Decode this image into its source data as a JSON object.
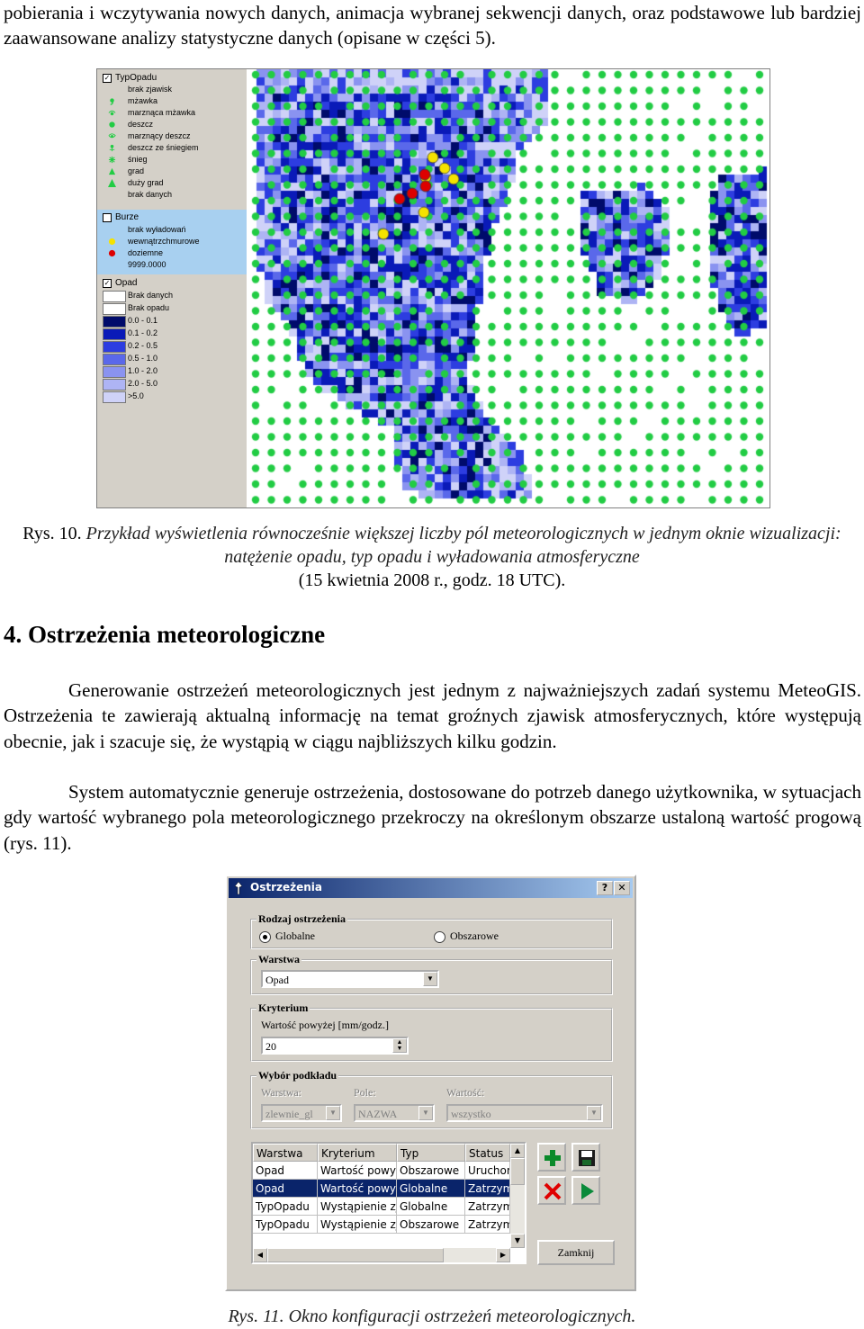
{
  "intro_text": "pobierania i wczytywania nowych danych, animacja wybranej sekwencji danych, oraz podstawowe lub bardziej zaawansowane analizy statystyczne danych (opisane w części 5).",
  "figure10": {
    "legend": {
      "typ_opadu": {
        "header": "TypOpadu",
        "items": [
          {
            "label": "brak zjawisk",
            "icon": "none"
          },
          {
            "label": "mżawka",
            "icon": "comma-icon"
          },
          {
            "label": "marznąca mżawka",
            "icon": "freezing-drizzle-icon"
          },
          {
            "label": "deszcz",
            "icon": "dot-icon"
          },
          {
            "label": "marznący deszcz",
            "icon": "freezing-rain-icon"
          },
          {
            "label": "deszcz ze śniegiem",
            "icon": "rain-snow-icon"
          },
          {
            "label": "śnieg",
            "icon": "snow-icon"
          },
          {
            "label": "grad",
            "icon": "hail-triangle-icon"
          },
          {
            "label": "duży grad",
            "icon": "large-hail-triangle-icon"
          },
          {
            "label": "brak danych",
            "icon": "none"
          }
        ]
      },
      "burze": {
        "header": "Burze",
        "items": [
          {
            "label": "brak wyładowań",
            "icon": "none"
          },
          {
            "label": "wewnątrzchmurowe",
            "icon": "yellow-dot-icon"
          },
          {
            "label": "doziemne",
            "icon": "red-dot-icon"
          },
          {
            "label": "9999.0000",
            "icon": "none"
          }
        ]
      },
      "opad": {
        "header": "Opad",
        "items": [
          {
            "label": "Brak danych",
            "color": "#ffffff"
          },
          {
            "label": "Brak opadu",
            "color": "#ffffff"
          },
          {
            "label": "0.0 - 0.1",
            "color": "#000b6b"
          },
          {
            "label": "0.1 - 0.2",
            "color": "#0a1ab8"
          },
          {
            "label": "0.2 - 0.5",
            "color": "#2d3de0"
          },
          {
            "label": "0.5 - 1.0",
            "color": "#5a68ea"
          },
          {
            "label": "1.0 - 2.0",
            "color": "#8a93f0"
          },
          {
            "label": "2.0 - 5.0",
            "color": "#aeb4f4"
          },
          {
            "label": ">5.0",
            "color": "#cfd2f8"
          }
        ]
      }
    },
    "colors": {
      "green_point": "#22cc44",
      "yellow_point": "#f5e200",
      "red_point": "#dd0000"
    },
    "caption_number": "Rys. 10.",
    "caption_italic": "Przykład wyświetlenia równocześnie większej liczby pól meteorologicznych w jednym oknie wizualizacji: natężenie opadu, typ opadu i wyładowania atmosferyczne",
    "caption_date": "(15 kwietnia 2008 r., godz. 18 UTC)."
  },
  "section_heading": "4. Ostrzeżenia meteorologiczne",
  "paragraph1": "Generowanie ostrzeżeń meteorologicznych jest jednym z najważniejszych zadań systemu MeteoGIS. Ostrzeżenia te zawierają aktualną informację na temat groźnych zjawisk atmosferycznych, które występują obecnie, jak i szacuje się, że wystąpią w ciągu najbliższych kilku godzin.",
  "paragraph2": "System automatycznie generuje ostrzeżenia, dostosowane do potrzeb danego użytkownika, w sytuacjach gdy wartość wybranego pola meteorologicznego przekroczy na określonym obszarze ustaloną wartość progową (rys. 11).",
  "dialog": {
    "title": "Ostrzeżenia",
    "help_button": "?",
    "close_button": "✕",
    "rodzaj": {
      "title": "Rodzaj ostrzeżenia",
      "option_global": "Globalne",
      "option_area": "Obszarowe",
      "selected": "Globalne"
    },
    "warstwa": {
      "title": "Warstwa",
      "value": "Opad"
    },
    "kryterium": {
      "title": "Kryterium",
      "label": "Wartość powyżej [mm/godz.]",
      "value": "20"
    },
    "podklad": {
      "title": "Wybór podkładu",
      "warstwa_label": "Warstwa:",
      "warstwa_value": "zlewnie_gl",
      "pole_label": "Pole:",
      "pole_value": "NAZWA",
      "wartosc_label": "Wartość:",
      "wartosc_value": "wszystko"
    },
    "table": {
      "columns": [
        "Warstwa",
        "Kryterium",
        "Typ",
        "Status"
      ],
      "rows": [
        [
          "Opad",
          "Wartość powyż",
          "Obszarowe",
          "Uruchon"
        ],
        [
          "Opad",
          "Wartość powyż",
          "Globalne",
          "Zatrzyma"
        ],
        [
          "TypOpadu",
          "Wystąpienie zja",
          "Globalne",
          "Zatrzyma"
        ],
        [
          "TypOpadu",
          "Wystąpienie zja",
          "Obszarowe",
          "Zatrzyma"
        ]
      ],
      "selected_row": 1
    },
    "buttons": {
      "add_icon": "plus-icon",
      "save_icon": "floppy-disk-icon",
      "delete_icon": "red-x-icon",
      "run_icon": "play-icon",
      "close_label": "Zamknij"
    }
  },
  "figure11_caption": "Rys. 11. Okno konfiguracji ostrzeżeń meteorologicznych."
}
